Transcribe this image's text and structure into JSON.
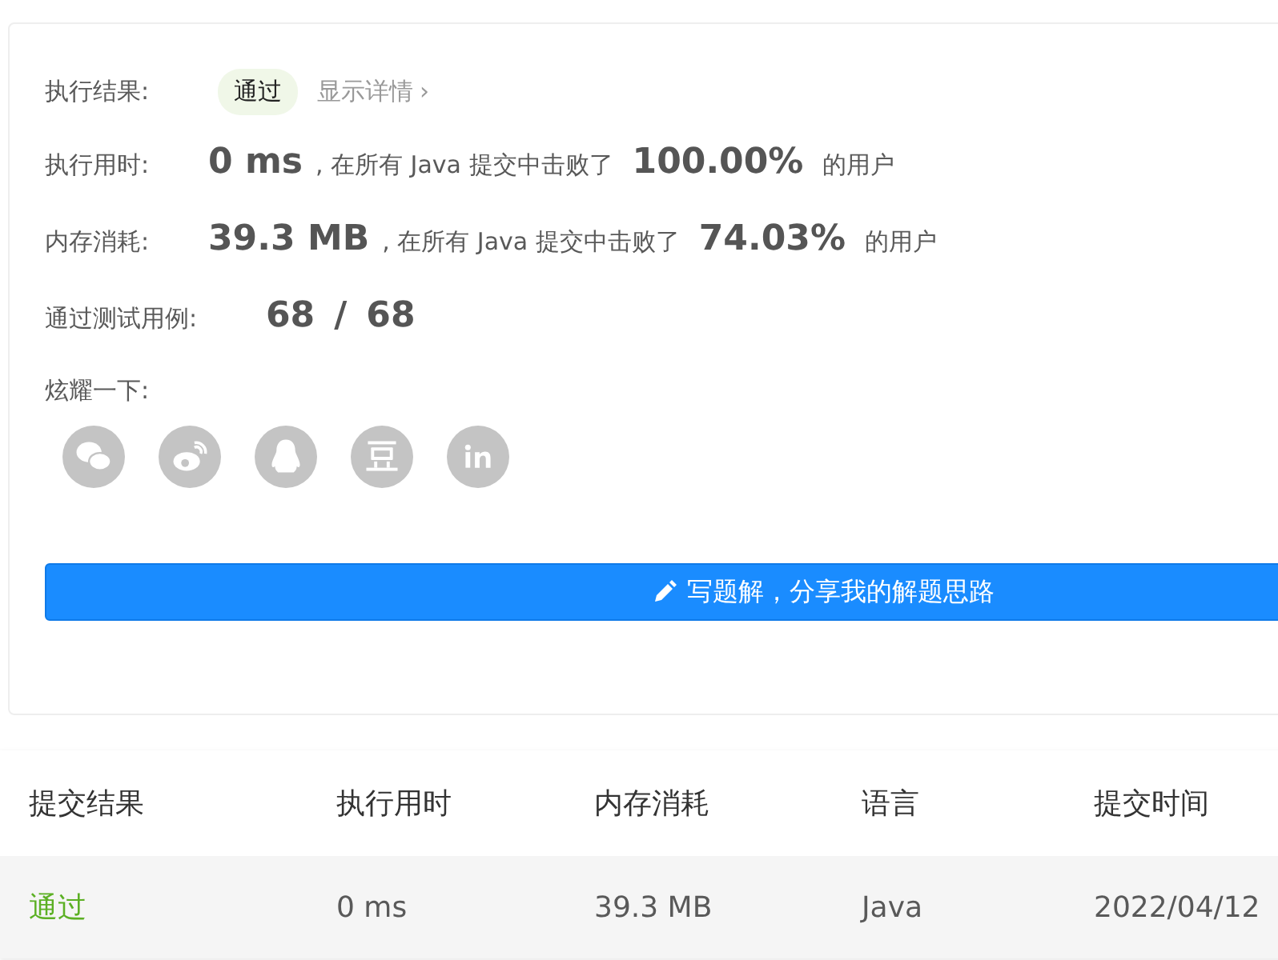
{
  "result": {
    "label": "执行结果:",
    "status": "通过",
    "details_link": "显示详情",
    "details_arrow": "›"
  },
  "stats": [
    {
      "label": "执行用时:",
      "value": "0 ms",
      "text_before": ", 在所有 Java 提交中击败了",
      "percent": "100.00%",
      "text_after": "的用户"
    },
    {
      "label": "内存消耗:",
      "value": "39.3 MB",
      "text_before": ", 在所有 Java 提交中击败了",
      "percent": "74.03%",
      "text_after": "的用户"
    }
  ],
  "tests": {
    "label": "通过测试用例:",
    "passed": "68",
    "separator": "/",
    "total": "68"
  },
  "share": {
    "label": "炫耀一下:",
    "icons": [
      {
        "kind": "wechat"
      },
      {
        "kind": "weibo"
      },
      {
        "kind": "qq"
      },
      {
        "kind": "douban"
      },
      {
        "kind": "linkedin"
      }
    ]
  },
  "write_button": "写题解，分享我的解题思路",
  "table": {
    "columns": [
      "提交结果",
      "执行用时",
      "内存消耗",
      "语言",
      "提交时间"
    ],
    "rows": [
      {
        "cells": [
          "通过",
          "0 ms",
          "39.3 MB",
          "Java",
          "2022/04/12"
        ]
      }
    ]
  }
}
